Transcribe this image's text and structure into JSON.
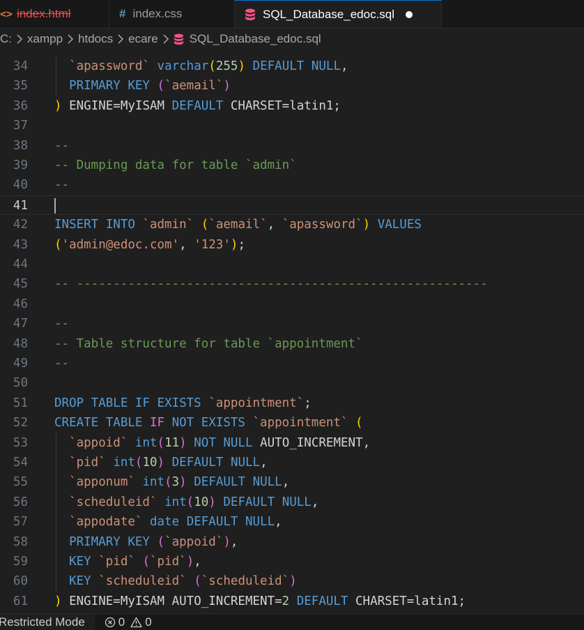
{
  "tabs": [
    {
      "label": "index.html",
      "icon": "html-icon",
      "state": "error"
    },
    {
      "label": "index.css",
      "icon": "css-icon",
      "state": "normal"
    },
    {
      "label": "SQL_Database_edoc.sql",
      "icon": "database-icon",
      "state": "active-modified"
    }
  ],
  "breadcrumb": {
    "items": [
      "C:",
      "xampp",
      "htdocs",
      "ecare"
    ],
    "file": "SQL_Database_edoc.sql"
  },
  "editor": {
    "current_line": "41",
    "lines": [
      {
        "n": "34",
        "tokens": [
          [
            "tx",
            "  "
          ],
          [
            "str",
            "`apassword`"
          ],
          [
            "tx",
            " "
          ],
          [
            "kw",
            "varchar"
          ],
          [
            "pn",
            "("
          ],
          [
            "num",
            "255"
          ],
          [
            "pn",
            ")"
          ],
          [
            "tx",
            " "
          ],
          [
            "kw",
            "DEFAULT"
          ],
          [
            "tx",
            " "
          ],
          [
            "kw",
            "NULL"
          ],
          [
            "tx",
            ","
          ]
        ]
      },
      {
        "n": "35",
        "tokens": [
          [
            "tx",
            "  "
          ],
          [
            "kw",
            "PRIMARY KEY"
          ],
          [
            "tx",
            " "
          ],
          [
            "pl",
            "("
          ],
          [
            "str",
            "`aemail`"
          ],
          [
            "pl",
            ")"
          ]
        ]
      },
      {
        "n": "36",
        "tokens": [
          [
            "pn",
            ")"
          ],
          [
            "tx",
            " ENGINE=MyISAM "
          ],
          [
            "kw",
            "DEFAULT"
          ],
          [
            "tx",
            " CHARSET=latin1;"
          ]
        ]
      },
      {
        "n": "37",
        "tokens": []
      },
      {
        "n": "38",
        "tokens": [
          [
            "cm",
            "--"
          ]
        ]
      },
      {
        "n": "39",
        "tokens": [
          [
            "cm",
            "-- Dumping data for table `admin`"
          ]
        ]
      },
      {
        "n": "40",
        "tokens": [
          [
            "cm",
            "--"
          ]
        ]
      },
      {
        "n": "41",
        "tokens": []
      },
      {
        "n": "42",
        "tokens": [
          [
            "kw",
            "INSERT INTO"
          ],
          [
            "tx",
            " "
          ],
          [
            "str",
            "`admin`"
          ],
          [
            "tx",
            " "
          ],
          [
            "pn",
            "("
          ],
          [
            "str",
            "`aemail`"
          ],
          [
            "tx",
            ", "
          ],
          [
            "str",
            "`apassword`"
          ],
          [
            "pn",
            ")"
          ],
          [
            "tx",
            " "
          ],
          [
            "kw",
            "VALUES"
          ]
        ]
      },
      {
        "n": "43",
        "tokens": [
          [
            "pn",
            "("
          ],
          [
            "str",
            "'admin@edoc.com'"
          ],
          [
            "tx",
            ", "
          ],
          [
            "str",
            "'123'"
          ],
          [
            "pn",
            ")"
          ],
          [
            "tx",
            ";"
          ]
        ]
      },
      {
        "n": "44",
        "tokens": []
      },
      {
        "n": "45",
        "tokens": [
          [
            "cm",
            "-- --------------------------------------------------------"
          ]
        ]
      },
      {
        "n": "46",
        "tokens": []
      },
      {
        "n": "47",
        "tokens": [
          [
            "cm",
            "--"
          ]
        ]
      },
      {
        "n": "48",
        "tokens": [
          [
            "cm",
            "-- Table structure for table `appointment`"
          ]
        ]
      },
      {
        "n": "49",
        "tokens": [
          [
            "cm",
            "--"
          ]
        ]
      },
      {
        "n": "50",
        "tokens": []
      },
      {
        "n": "51",
        "tokens": [
          [
            "kw",
            "DROP TABLE IF EXISTS"
          ],
          [
            "tx",
            " "
          ],
          [
            "str",
            "`appointment`"
          ],
          [
            "tx",
            ";"
          ]
        ]
      },
      {
        "n": "52",
        "tokens": [
          [
            "kw",
            "CREATE TABLE"
          ],
          [
            "tx",
            " "
          ],
          [
            "pl",
            "IF"
          ],
          [
            "tx",
            " "
          ],
          [
            "kw",
            "NOT EXISTS"
          ],
          [
            "tx",
            " "
          ],
          [
            "str",
            "`appointment`"
          ],
          [
            "tx",
            " "
          ],
          [
            "pn",
            "("
          ]
        ]
      },
      {
        "n": "53",
        "tokens": [
          [
            "tx",
            "  "
          ],
          [
            "str",
            "`appoid`"
          ],
          [
            "tx",
            " "
          ],
          [
            "kw",
            "int"
          ],
          [
            "pl",
            "("
          ],
          [
            "num",
            "11"
          ],
          [
            "pl",
            ")"
          ],
          [
            "tx",
            " "
          ],
          [
            "kw",
            "NOT NULL"
          ],
          [
            "tx",
            " AUTO_INCREMENT,"
          ]
        ]
      },
      {
        "n": "54",
        "tokens": [
          [
            "tx",
            "  "
          ],
          [
            "str",
            "`pid`"
          ],
          [
            "tx",
            " "
          ],
          [
            "kw",
            "int"
          ],
          [
            "pl",
            "("
          ],
          [
            "num",
            "10"
          ],
          [
            "pl",
            ")"
          ],
          [
            "tx",
            " "
          ],
          [
            "kw",
            "DEFAULT"
          ],
          [
            "tx",
            " "
          ],
          [
            "kw",
            "NULL"
          ],
          [
            "tx",
            ","
          ]
        ]
      },
      {
        "n": "55",
        "tokens": [
          [
            "tx",
            "  "
          ],
          [
            "str",
            "`apponum`"
          ],
          [
            "tx",
            " "
          ],
          [
            "kw",
            "int"
          ],
          [
            "pl",
            "("
          ],
          [
            "num",
            "3"
          ],
          [
            "pl",
            ")"
          ],
          [
            "tx",
            " "
          ],
          [
            "kw",
            "DEFAULT"
          ],
          [
            "tx",
            " "
          ],
          [
            "kw",
            "NULL"
          ],
          [
            "tx",
            ","
          ]
        ]
      },
      {
        "n": "56",
        "tokens": [
          [
            "tx",
            "  "
          ],
          [
            "str",
            "`scheduleid`"
          ],
          [
            "tx",
            " "
          ],
          [
            "kw",
            "int"
          ],
          [
            "pl",
            "("
          ],
          [
            "num",
            "10"
          ],
          [
            "pl",
            ")"
          ],
          [
            "tx",
            " "
          ],
          [
            "kw",
            "DEFAULT"
          ],
          [
            "tx",
            " "
          ],
          [
            "kw",
            "NULL"
          ],
          [
            "tx",
            ","
          ]
        ]
      },
      {
        "n": "57",
        "tokens": [
          [
            "tx",
            "  "
          ],
          [
            "str",
            "`appodate`"
          ],
          [
            "tx",
            " "
          ],
          [
            "kw",
            "date"
          ],
          [
            "tx",
            " "
          ],
          [
            "kw",
            "DEFAULT"
          ],
          [
            "tx",
            " "
          ],
          [
            "kw",
            "NULL"
          ],
          [
            "tx",
            ","
          ]
        ]
      },
      {
        "n": "58",
        "tokens": [
          [
            "tx",
            "  "
          ],
          [
            "kw",
            "PRIMARY KEY"
          ],
          [
            "tx",
            " "
          ],
          [
            "pl",
            "("
          ],
          [
            "str",
            "`appoid`"
          ],
          [
            "pl",
            ")"
          ],
          [
            "tx",
            ","
          ]
        ]
      },
      {
        "n": "59",
        "tokens": [
          [
            "tx",
            "  "
          ],
          [
            "kw",
            "KEY"
          ],
          [
            "tx",
            " "
          ],
          [
            "str",
            "`pid`"
          ],
          [
            "tx",
            " "
          ],
          [
            "pl",
            "("
          ],
          [
            "str",
            "`pid`"
          ],
          [
            "pl",
            ")"
          ],
          [
            "tx",
            ","
          ]
        ]
      },
      {
        "n": "60",
        "tokens": [
          [
            "tx",
            "  "
          ],
          [
            "kw",
            "KEY"
          ],
          [
            "tx",
            " "
          ],
          [
            "str",
            "`scheduleid`"
          ],
          [
            "tx",
            " "
          ],
          [
            "pl",
            "("
          ],
          [
            "str",
            "`scheduleid`"
          ],
          [
            "pl",
            ")"
          ]
        ]
      },
      {
        "n": "61",
        "tokens": [
          [
            "pn",
            ")"
          ],
          [
            "tx",
            " ENGINE=MyISAM AUTO_INCREMENT="
          ],
          [
            "num",
            "2"
          ],
          [
            "tx",
            " "
          ],
          [
            "kw",
            "DEFAULT"
          ],
          [
            "tx",
            " CHARSET=latin1;"
          ]
        ]
      }
    ]
  },
  "statusbar": {
    "mode": "Restricted Mode",
    "errors": "0",
    "warnings": "0"
  },
  "colors": {
    "keyword": "#569cd6",
    "string": "#ce9178",
    "number": "#b5cea8",
    "comment": "#6a9955",
    "bracket_gold": "#ffd700",
    "bracket_purple": "#da70d6",
    "error_tab": "#f14c4c"
  }
}
